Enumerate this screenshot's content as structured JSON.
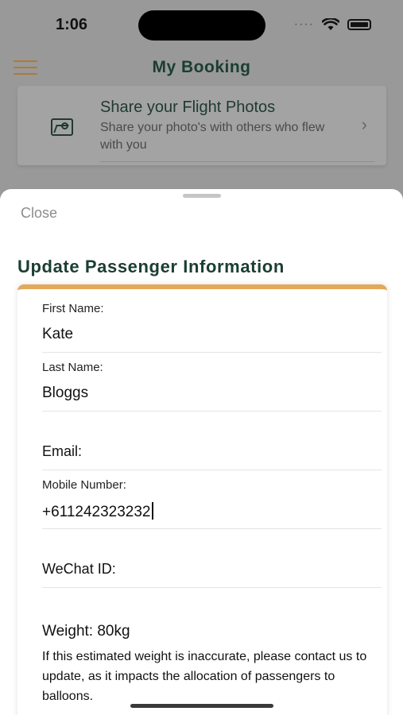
{
  "status_bar": {
    "time": "1:06"
  },
  "header": {
    "title": "My Booking"
  },
  "photo_card": {
    "title": "Share your Flight Photos",
    "subtitle": "Share your photo's with others who flew with you"
  },
  "sheet": {
    "close_label": "Close",
    "title": "Update Passenger Information"
  },
  "form": {
    "first_name_label": "First Name:",
    "first_name_value": "Kate",
    "last_name_label": "Last Name:",
    "last_name_value": "Bloggs",
    "email_label": "Email:",
    "mobile_label": "Mobile Number:",
    "mobile_value": "+611242323232",
    "wechat_label": "WeChat ID:",
    "weight_label": "Weight: 80kg",
    "weight_note": "If this estimated weight is inaccurate, please contact us to update, as it impacts the allocation of passengers to balloons."
  },
  "colors": {
    "brand_green": "#1b3e30",
    "accent_orange": "#e3a95a"
  }
}
